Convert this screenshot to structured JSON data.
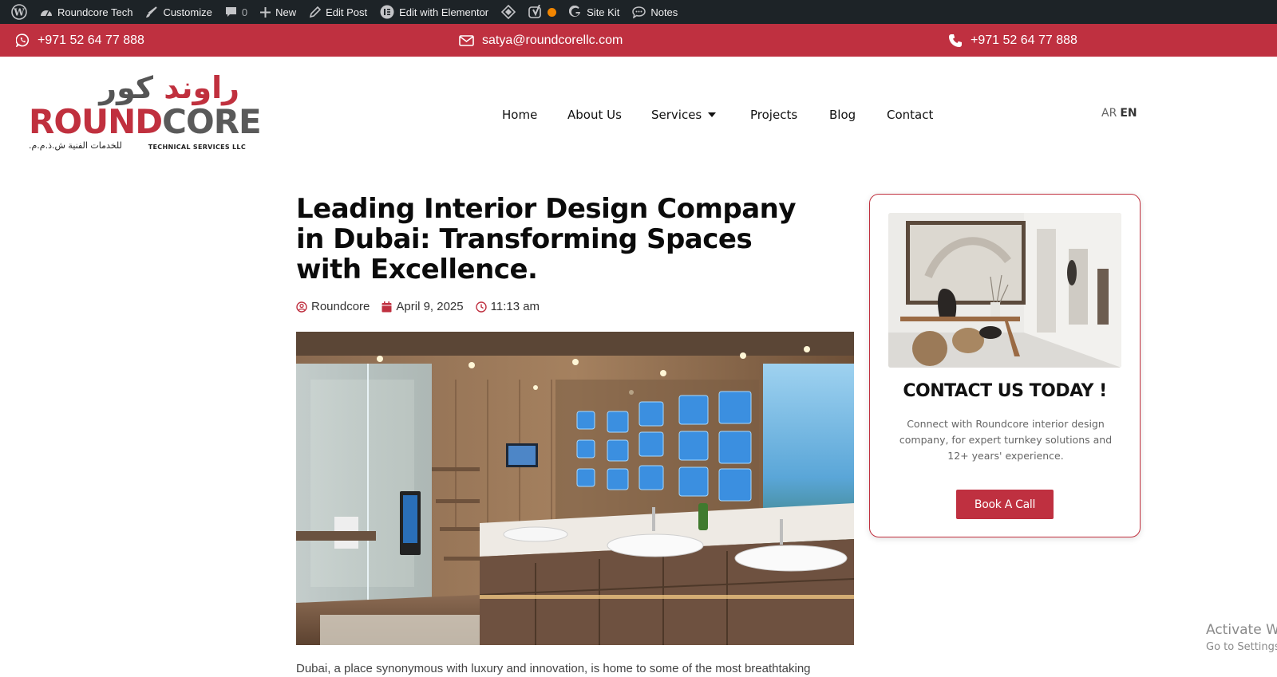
{
  "admin_bar": {
    "site_name": "Roundcore Tech",
    "customize": "Customize",
    "comments_count": "0",
    "new": "New",
    "edit_post": "Edit Post",
    "edit_elementor": "Edit with Elementor",
    "site_kit": "Site Kit",
    "notes": "Notes"
  },
  "top_bar": {
    "whatsapp": "+971 52 64 77 888",
    "email": "satya@roundcorellc.com",
    "phone": "+971 52 64 77 888"
  },
  "logo": {
    "arabic_red": "راوند",
    "arabic_dark": "كور",
    "word_red": "ROUND",
    "word_gray": "CORE",
    "arabic_sub": "للخدمات الفنية ش.ذ.م.م.",
    "english_sub": "TECHNICAL SERVICES LLC"
  },
  "nav": {
    "home": "Home",
    "about": "About Us",
    "services": "Services",
    "projects": "Projects",
    "blog": "Blog",
    "contact": "Contact"
  },
  "lang": {
    "ar": "AR",
    "en": "EN"
  },
  "article": {
    "title": "Leading Interior Design Company in Dubai: Transforming Spaces with Excellence.",
    "author": "Roundcore",
    "date": "April 9, 2025",
    "time": "11:13 am",
    "intro": "Dubai, a place synonymous with luxury and innovation, is home to some of the most breathtaking"
  },
  "sidebar": {
    "heading": "CONTACT US TODAY !",
    "text": "Connect with Roundcore interior design company, for expert turnkey solutions and 12+ years' experience.",
    "button": "Book A Call"
  },
  "watermark": {
    "line1": "Activate W",
    "line2": "Go to Settings"
  },
  "colors": {
    "brand_red": "#bf3040",
    "admin_bar": "#1d2327"
  }
}
